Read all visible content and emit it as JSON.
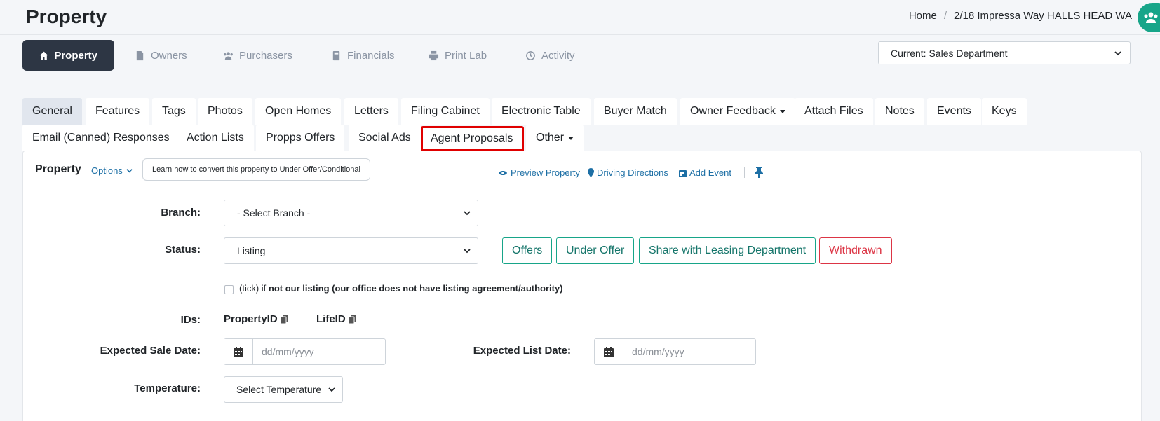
{
  "header": {
    "title": "Property",
    "breadcrumb": [
      "Home",
      "/",
      "2/18 Impressa Way HALLS HEAD WA"
    ]
  },
  "module_tabs": [
    {
      "label": "Property",
      "icon": "home-icon",
      "active": true
    },
    {
      "label": "Owners",
      "icon": "file-icon",
      "active": false
    },
    {
      "label": "Purchasers",
      "icon": "users-icon",
      "active": false
    },
    {
      "label": "Financials",
      "icon": "calculator-icon",
      "active": false
    },
    {
      "label": "Print Lab",
      "icon": "printer-icon",
      "active": false
    },
    {
      "label": "Activity",
      "icon": "history-icon",
      "active": false
    }
  ],
  "department_select": {
    "value": "Current: Sales Department"
  },
  "sub_tabs_row1": [
    "General",
    "Features",
    "Tags",
    "Photos",
    "Open Homes",
    "Letters",
    "Filing Cabinet",
    "Electronic Table",
    "Buyer Match",
    "Owner Feedback",
    "Attach Files",
    "Notes",
    "Events",
    "Keys"
  ],
  "sub_tabs_row2": [
    "Email (Canned) Responses",
    "Action Lists",
    "Propps Offers",
    "Social Ads",
    "Agent Proposals",
    "Other"
  ],
  "panel": {
    "title": "Property",
    "options_label": "Options",
    "learn_button": "Learn how to convert this property to Under Offer/Conditional",
    "links": {
      "preview": "Preview Property",
      "directions": "Driving Directions",
      "add_event": "Add Event"
    }
  },
  "form": {
    "branch_label": "Branch:",
    "branch_value": "- Select Branch -",
    "status_label": "Status:",
    "status_value": "Listing",
    "status_buttons": [
      "Offers",
      "Under Offer",
      "Share with Leasing Department",
      "Withdrawn"
    ],
    "not_listing_prefix": "(tick) if ",
    "not_listing_bold": "not our listing",
    "not_listing_suffix": " (our office does not have listing agreement/authority)",
    "ids_label": "IDs:",
    "property_id_label": "PropertyID",
    "life_id_label": "LifeID",
    "expected_sale_label": "Expected Sale Date:",
    "expected_list_label": "Expected List Date:",
    "date_placeholder": "dd/mm/yyyy",
    "temperature_label": "Temperature:",
    "temperature_value": "Select Temperature"
  },
  "colors": {
    "accent_teal": "#17a589",
    "danger": "#dc3545",
    "link": "#1d6fa5",
    "dark_tab": "#2d3644",
    "highlight": "#e00000"
  }
}
